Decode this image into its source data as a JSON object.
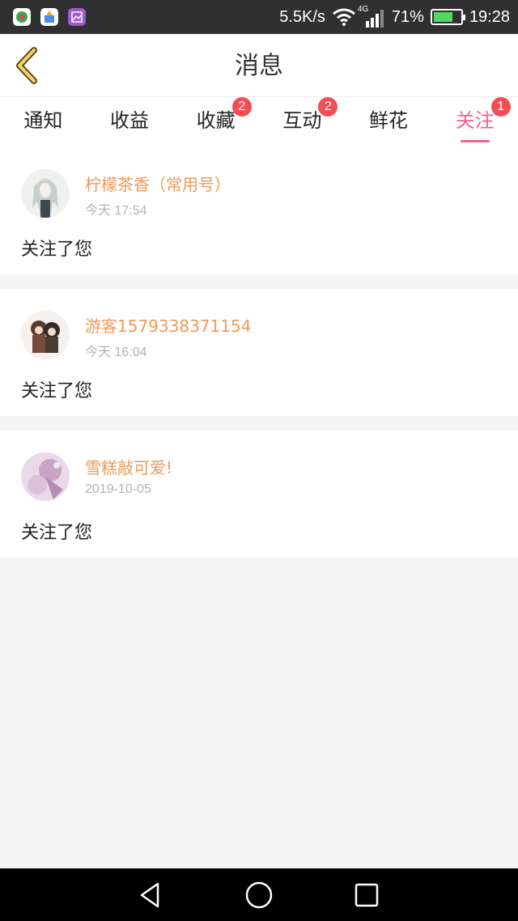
{
  "status_bar": {
    "network_speed": "5.5K/s",
    "network_type": "4G",
    "battery": "71%",
    "time": "19:28",
    "left_icons": [
      "app-icon-1",
      "app-icon-2",
      "gallery-icon"
    ]
  },
  "header": {
    "title": "消息",
    "back_icon": "chevron-left-icon"
  },
  "tabs": [
    {
      "label": "通知",
      "badge": null,
      "active": false
    },
    {
      "label": "收益",
      "badge": null,
      "active": false
    },
    {
      "label": "收藏",
      "badge": "2",
      "active": false
    },
    {
      "label": "互动",
      "badge": "2",
      "active": false
    },
    {
      "label": "鲜花",
      "badge": null,
      "active": false
    },
    {
      "label": "关注",
      "badge": "1",
      "active": true
    }
  ],
  "messages": [
    {
      "username": "柠檬茶香（常用号）",
      "time": "今天 17:54",
      "content": "关注了您"
    },
    {
      "username": "游客1579338371154",
      "time": "今天 16:04",
      "content": "关注了您"
    },
    {
      "username": "雪糕敲可爱!",
      "time": "2019-10-05",
      "content": "关注了您"
    }
  ],
  "colors": {
    "accent": "#f06292",
    "username": "#ee9a5b",
    "badge": "#f24e56",
    "background": "#f5f5f5"
  }
}
